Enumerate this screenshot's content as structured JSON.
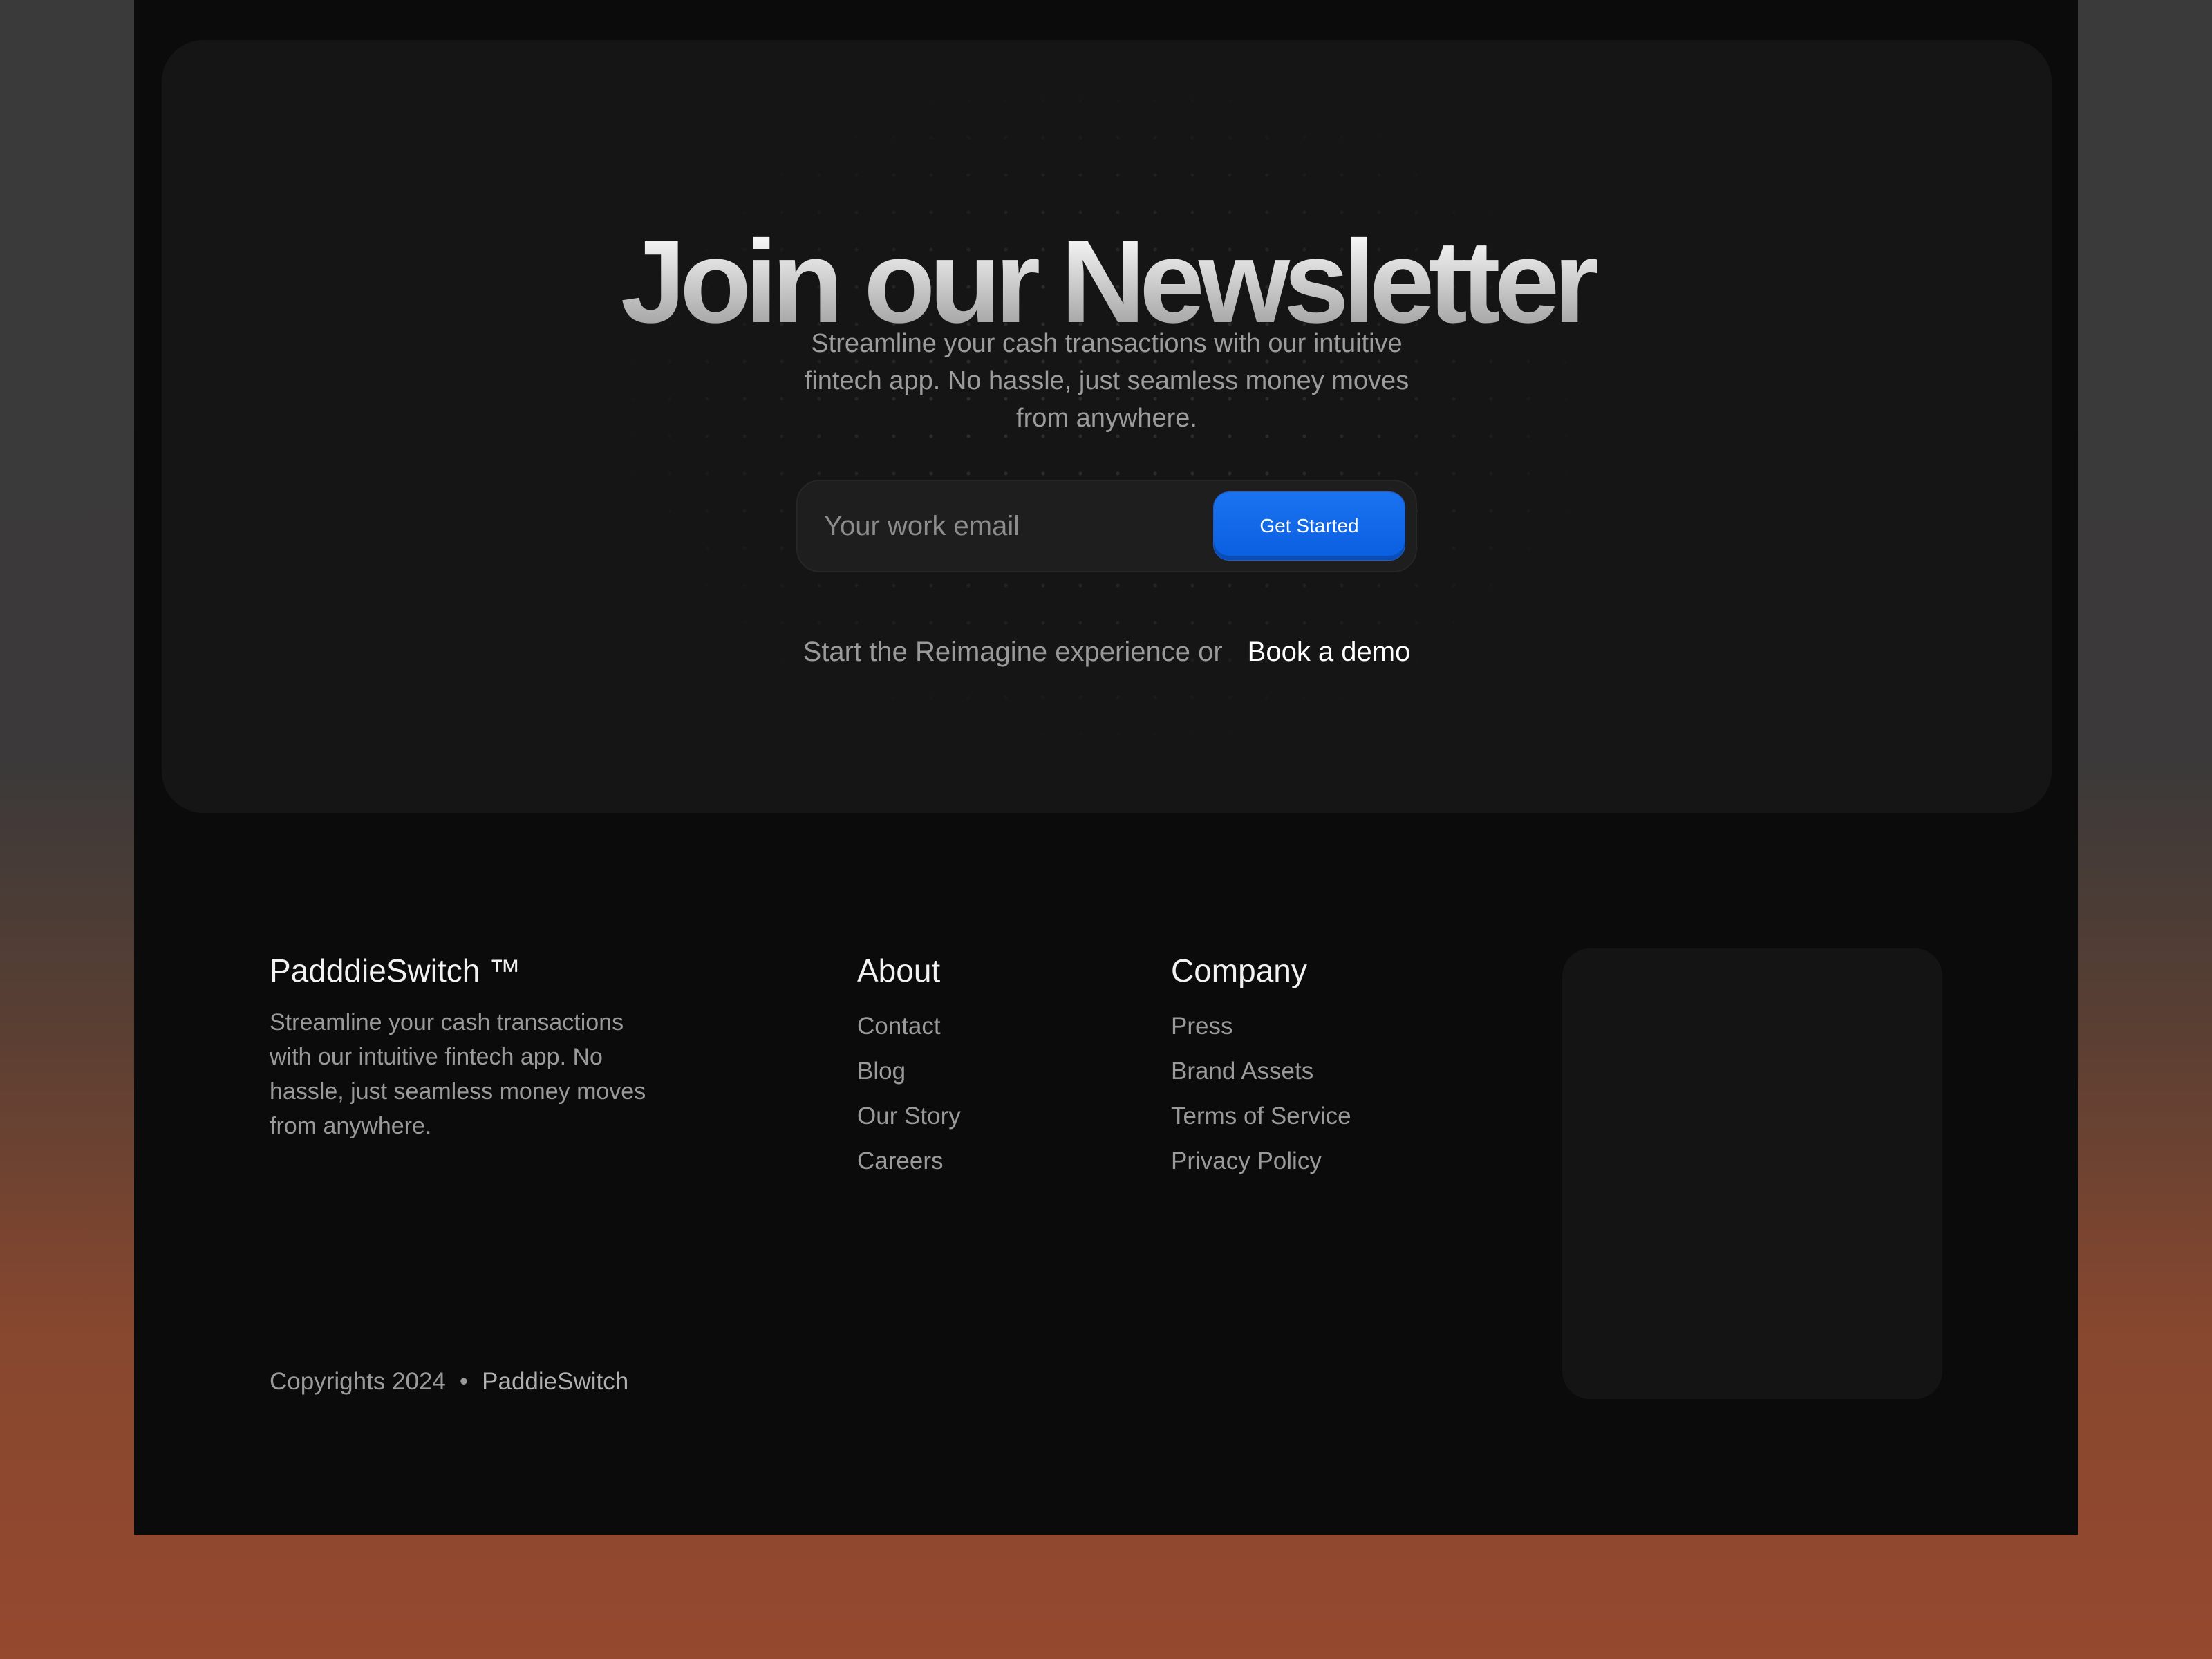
{
  "newsletter": {
    "title": "Join our Newsletter",
    "description": "Streamline your cash transactions with our intuitive fintech app. No  hassle, just seamless money moves from anywhere.",
    "email_placeholder": "Your work email",
    "cta_label": "Get Started",
    "sub_text": "Start the Reimagine experience or",
    "demo_link": "Book a demo"
  },
  "footer": {
    "brand": "PadddieSwitch ™",
    "tagline": "Streamline your cash transactions with our intuitive fintech app. No hassle, just seamless money moves from anywhere.",
    "about": {
      "heading": "About",
      "links": [
        "Contact",
        "Blog",
        "Our Story",
        "Careers"
      ]
    },
    "company": {
      "heading": "Company",
      "links": [
        "Press",
        "Brand Assets",
        "Terms of Service",
        "Privacy Policy"
      ]
    },
    "copyright": "Copyrights 2024",
    "separator": "•",
    "copyright_brand": "PaddieSwitch"
  },
  "colors": {
    "accent": "#0a63e6",
    "panel_background": "#0b0b0b",
    "card_background": "#151515"
  }
}
